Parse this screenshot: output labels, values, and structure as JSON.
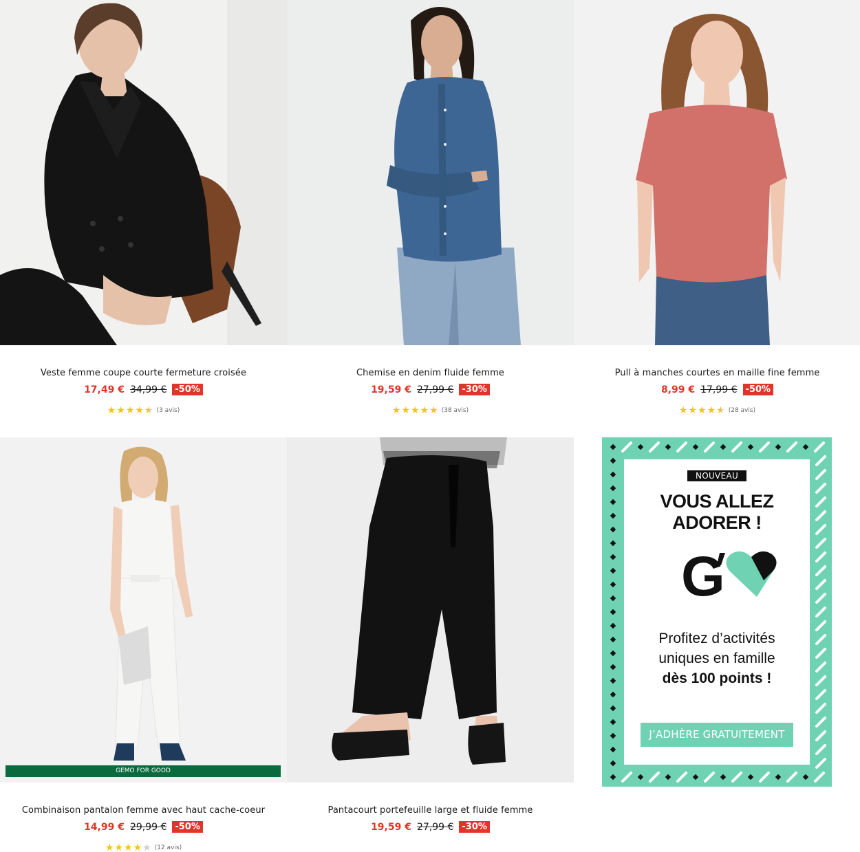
{
  "products": [
    {
      "name": "Veste femme coupe courte fermeture croisée",
      "price": "17,49 €",
      "old_price": "34,99 €",
      "discount": "-50%",
      "rating": 4.5,
      "reviews": "(3 avis)",
      "image_dots": 2,
      "colors": {
        "bg": "#f1f1f0",
        "garment": "#141414",
        "skin": "#e6c1a9",
        "hair": "#5a3d2b"
      }
    },
    {
      "name": "Chemise en denim fluide femme",
      "price": "19,59 €",
      "old_price": "27,99 €",
      "discount": "-30%",
      "rating": 5,
      "reviews": "(38 avis)",
      "image_dots": 1,
      "colors": {
        "bg": "#eceeee",
        "garment": "#3e6695",
        "skin": "#d9ad92",
        "hair": "#241a14"
      }
    },
    {
      "name": "Pull à manches courtes en maille fine femme",
      "price": "8,99 €",
      "old_price": "17,99 €",
      "discount": "-50%",
      "rating": 4.5,
      "reviews": "(28 avis)",
      "image_dots": 2,
      "colors": {
        "bg": "#f2f2f2",
        "garment": "#d2706a",
        "skin": "#f0c8b1",
        "hair": "#8a5531"
      }
    },
    {
      "name": "Combinaison pantalon femme avec haut cache-coeur",
      "price": "14,99 €",
      "old_price": "29,99 €",
      "discount": "-50%",
      "rating": 4,
      "reviews": "(12 avis)",
      "image_dots": 4,
      "badge": "GEMO FOR GOOD",
      "colors": {
        "bg": "#f2f2f2",
        "garment": "#f6f6f4",
        "skin": "#f0cdb6",
        "hair": "#d1ab72"
      }
    },
    {
      "name": "Pantacourt portefeuille large et fluide femme",
      "price": "19,59 €",
      "old_price": "27,99 €",
      "discount": "-30%",
      "image_dots": 1,
      "colors": {
        "bg": "#ededed",
        "garment": "#121212",
        "skin": "#e9c3ad",
        "hair": "#000000"
      }
    }
  ],
  "promo": {
    "tag": "NOUVEAU",
    "title_line1": "VOUS ALLEZ",
    "title_line2": "ADORER !",
    "logo_letter": "G",
    "text_line1": "Profitez d’activités",
    "text_line2": "uniques en famille",
    "text_line3": "dès 100 points !",
    "button": "J’ADHÈRE GRATUITEMENT",
    "colors": {
      "accent": "#6fd2b3",
      "dark": "#111111"
    }
  }
}
